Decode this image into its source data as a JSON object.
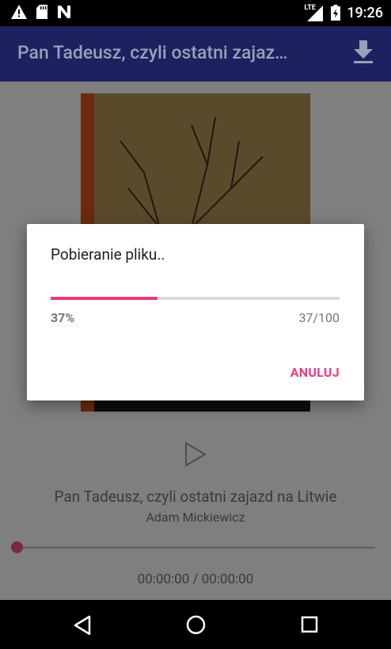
{
  "status_bar": {
    "time": "19:26",
    "network_label": "LTE",
    "icons": [
      "warning-icon",
      "sd-card-icon",
      "n-icon",
      "signal-icon",
      "battery-icon"
    ]
  },
  "app_bar": {
    "title": "Pan Tadeusz, czyli ostatni zajaz…",
    "action_icon": "download-icon"
  },
  "player": {
    "cover_icon": "book-cover-image",
    "play_icon": "play-icon",
    "book_title": "Pan Tadeusz, czyli ostatni zajazd na Litwie",
    "author": "Adam Mickiewicz",
    "elapsed_total": "00:00:00 / 00:00:00",
    "seek_progress": 0
  },
  "dialog": {
    "title": "Pobieranie pliku..",
    "progress_fraction": 0.37,
    "percent_label": "37%",
    "count_label": "37/100",
    "cancel_label": "ANULUJ"
  },
  "nav_bar": {
    "icons": [
      "back-icon",
      "home-icon",
      "recents-icon"
    ]
  },
  "colors": {
    "accent": "#e93a7e",
    "app_bar": "#1c2160",
    "scrim": "#7f7f7f"
  }
}
